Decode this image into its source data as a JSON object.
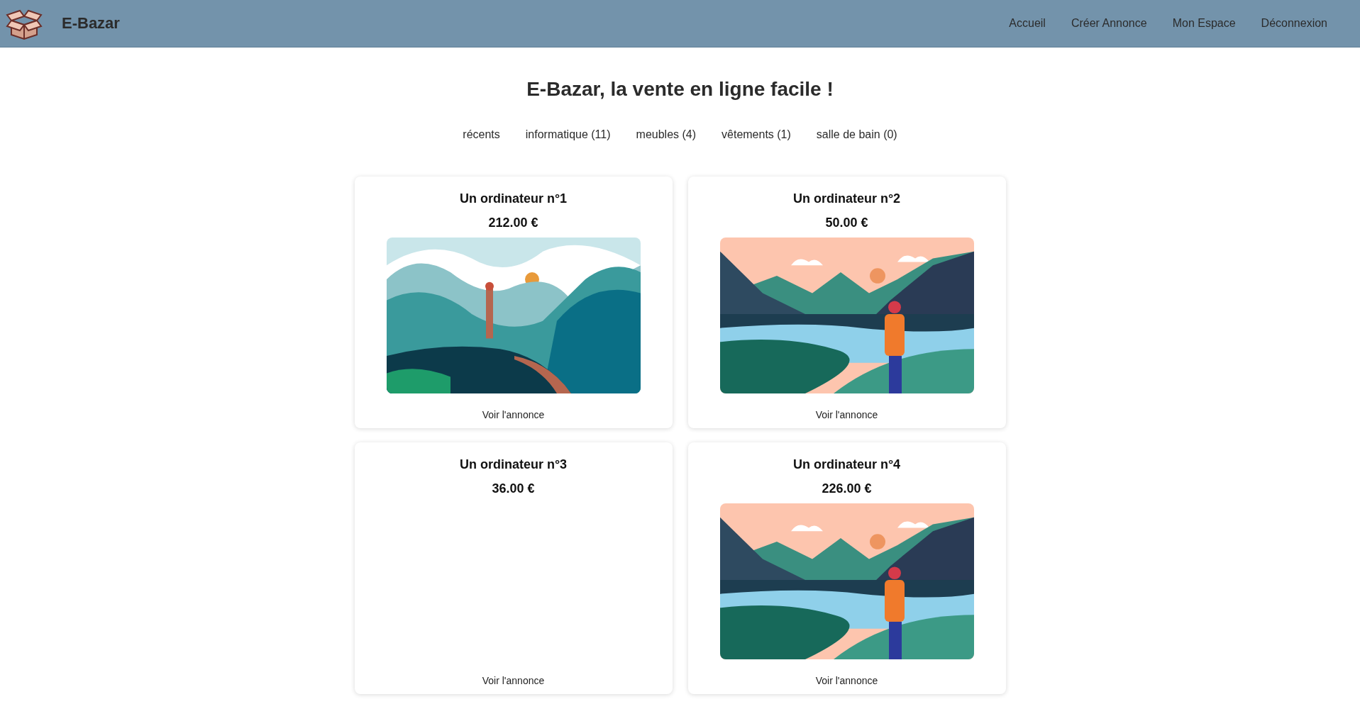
{
  "header": {
    "brand": "E-Bazar",
    "nav": [
      "Accueil",
      "Créer Annonce",
      "Mon Espace",
      "Déconnexion"
    ]
  },
  "title": "E-Bazar, la vente en ligne facile !",
  "categories": [
    "récents",
    "informatique (11)",
    "meubles (4)",
    "vêtements (1)",
    "salle de bain (0)"
  ],
  "listings": [
    {
      "title": "Un ordinateur n°1",
      "price": "212.00 €",
      "kind": "valley",
      "link": "Voir l'annonce"
    },
    {
      "title": "Un ordinateur n°2",
      "price": "50.00 €",
      "kind": "lake",
      "link": "Voir l'annonce"
    },
    {
      "title": "Un ordinateur n°3",
      "price": "36.00 €",
      "kind": "text",
      "link": "Voir l'annonce"
    },
    {
      "title": "Un ordinateur n°4",
      "price": "226.00 €",
      "kind": "lake",
      "link": "Voir l'annonce"
    }
  ]
}
